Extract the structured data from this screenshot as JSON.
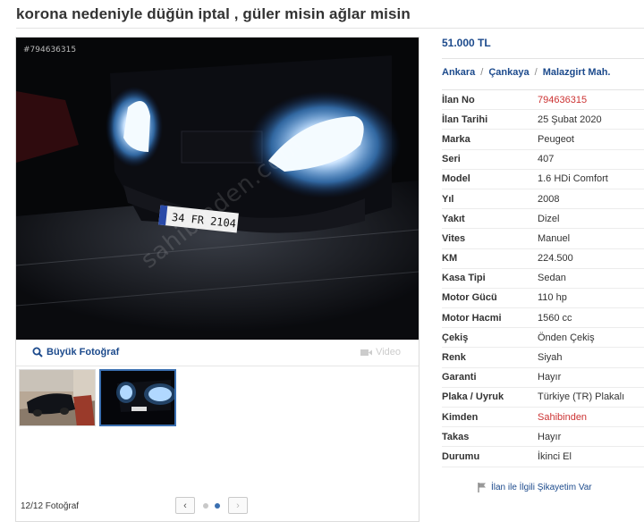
{
  "title": "korona nedeniyle düğün iptal , güler misin ağlar misin",
  "gallery": {
    "photo_id": "#794636315",
    "watermark": "sahibinden.com",
    "big_photo_label": "Büyük Fotoğraf",
    "video_label": "Video",
    "photo_count": "12/12 Fotoğraf",
    "plate": "34 FR 2104"
  },
  "price": "51.000 TL",
  "location": {
    "city": "Ankara",
    "district": "Çankaya",
    "neighborhood": "Malazgirt Mah."
  },
  "specs": [
    {
      "key": "İlan No",
      "value": "794636315",
      "red": true
    },
    {
      "key": "İlan Tarihi",
      "value": "25 Şubat 2020"
    },
    {
      "key": "Marka",
      "value": "Peugeot"
    },
    {
      "key": "Seri",
      "value": "407"
    },
    {
      "key": "Model",
      "value": "1.6 HDi Comfort"
    },
    {
      "key": "Yıl",
      "value": "2008"
    },
    {
      "key": "Yakıt",
      "value": "Dizel"
    },
    {
      "key": "Vites",
      "value": "Manuel"
    },
    {
      "key": "KM",
      "value": "224.500"
    },
    {
      "key": "Kasa Tipi",
      "value": "Sedan"
    },
    {
      "key": "Motor Gücü",
      "value": "110 hp"
    },
    {
      "key": "Motor Hacmi",
      "value": "1560 cc"
    },
    {
      "key": "Çekiş",
      "value": "Önden Çekiş"
    },
    {
      "key": "Renk",
      "value": "Siyah"
    },
    {
      "key": "Garanti",
      "value": "Hayır"
    },
    {
      "key": "Plaka / Uyruk",
      "value": "Türkiye (TR) Plakalı"
    },
    {
      "key": "Kimden",
      "value": "Sahibinden",
      "red": true
    },
    {
      "key": "Takas",
      "value": "Hayır"
    },
    {
      "key": "Durumu",
      "value": "İkinci El"
    }
  ],
  "report_label": "İlan ile İlgili Şikayetim Var",
  "colors": {
    "link": "#1c4a8c",
    "red": "#cc3333",
    "active": "#3a6fb0"
  }
}
